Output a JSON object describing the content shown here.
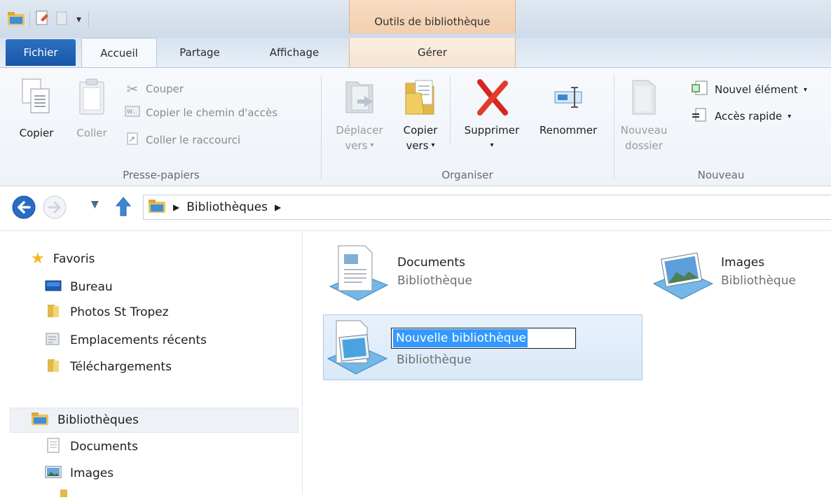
{
  "window": {
    "contextual_tab_group": "Outils de bibliothèque"
  },
  "ribbon_tabs": {
    "fichier": "Fichier",
    "accueil": "Accueil",
    "partage": "Partage",
    "affichage": "Affichage",
    "gerer": "Gérer"
  },
  "clipboard": {
    "copy": "Copier",
    "paste": "Coller",
    "cut": "Couper",
    "copy_path": "Copier le chemin d'accès",
    "paste_shortcut": "Coller le raccourci",
    "group_label": "Presse-papiers"
  },
  "organize": {
    "move_line1": "Déplacer",
    "move_line2": "vers",
    "copy_line1": "Copier",
    "copy_line2": "vers",
    "delete": "Supprimer",
    "rename": "Renommer",
    "group_label": "Organiser"
  },
  "new": {
    "folder_line1": "Nouveau",
    "folder_line2": "dossier",
    "new_item": "Nouvel élément",
    "easy_access": "Accès rapide",
    "group_label": "Nouveau"
  },
  "address": {
    "breadcrumb": "Bibliothèques"
  },
  "nav": {
    "favorites": "Favoris",
    "desktop": "Bureau",
    "photos": "Photos St Tropez",
    "recent": "Emplacements récents",
    "downloads": "Téléchargements",
    "libraries": "Bibliothèques",
    "documents": "Documents",
    "images": "Images"
  },
  "content": {
    "documents_name": "Documents",
    "documents_type": "Bibliothèque",
    "images_name": "Images",
    "images_type": "Bibliothèque",
    "new_library_name": "Nouvelle bibliothèque",
    "new_library_type": "Bibliothèque"
  },
  "colors": {
    "accent_blue": "#1857a8",
    "library_tools_orange": "#f2cfae",
    "selection_blue": "#3399ff"
  }
}
